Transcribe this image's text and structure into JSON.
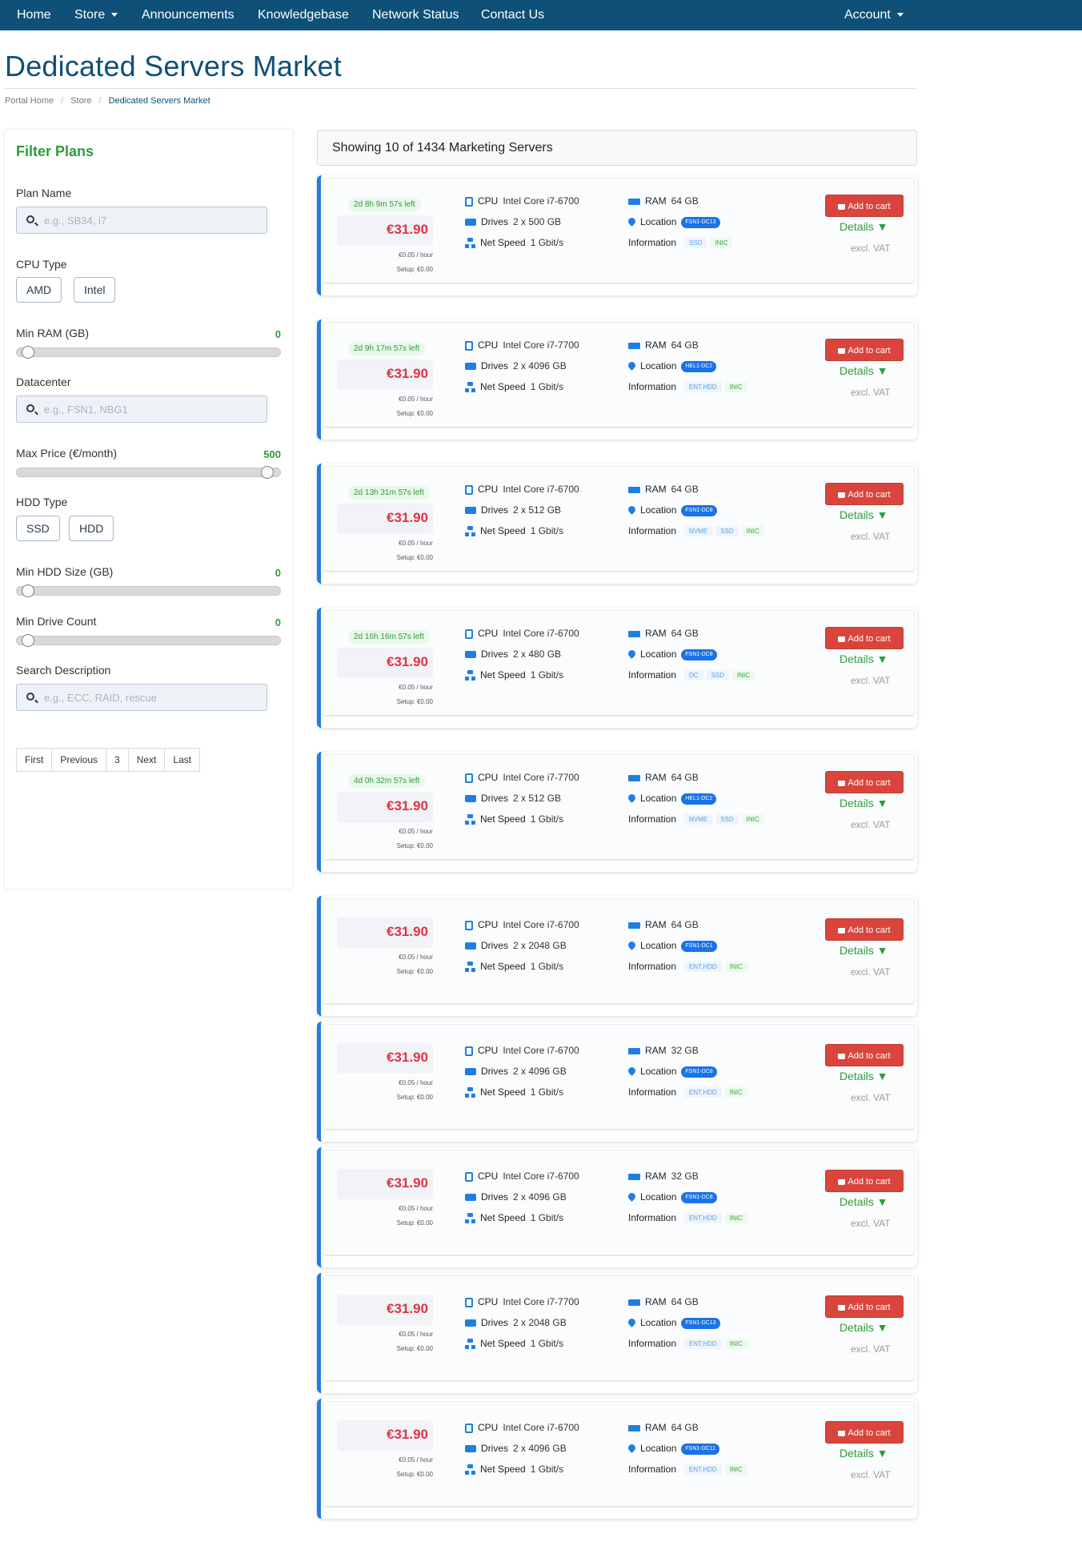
{
  "nav": {
    "home": "Home",
    "store": "Store",
    "announcements": "Announcements",
    "knowledgebase": "Knowledgebase",
    "network_status": "Network Status",
    "contact": "Contact Us",
    "account": "Account"
  },
  "page": {
    "title": "Dedicated Servers Market",
    "breadcrumb": [
      "Portal Home",
      "Store",
      "Dedicated Servers Market"
    ]
  },
  "filters": {
    "title": "Filter Plans",
    "plan_name_label": "Plan Name",
    "plan_name_placeholder": "e.g., SB34, i7",
    "cpu_type_label": "CPU Type",
    "cpu_options": [
      "AMD",
      "Intel"
    ],
    "min_ram_label": "Min RAM (GB)",
    "min_ram_value": "0",
    "datacenter_label": "Datacenter",
    "datacenter_placeholder": "e.g., FSN1, NBG1",
    "max_price_label": "Max Price (€/month)",
    "max_price_value": "500",
    "hdd_type_label": "HDD Type",
    "hdd_options": [
      "SSD",
      "HDD"
    ],
    "min_hdd_label": "Min HDD Size (GB)",
    "min_hdd_value": "0",
    "min_drive_label": "Min Drive Count",
    "min_drive_value": "0",
    "search_label": "Search Description",
    "search_placeholder": "e.g., ECC, RAID, rescue"
  },
  "pagination": {
    "first": "First",
    "previous": "Previous",
    "current": "3",
    "next": "Next",
    "last": "Last"
  },
  "results": {
    "showing": "Showing 10 of 1434 Marketing Servers"
  },
  "labels": {
    "cpu": "CPU",
    "drives": "Drives",
    "net_speed": "Net Speed",
    "ram": "RAM",
    "location": "Location",
    "information": "Information",
    "add_to_cart": "Add to cart",
    "details": "Details ▼",
    "excl_vat": "excl. VAT"
  },
  "colors": {
    "nav_bg": "#0e5077",
    "accent_blue": "#1f7fe0",
    "price_red": "#dc3545",
    "filter_green": "#2e9b3a",
    "cart_red": "#d9453d"
  },
  "servers": [
    {
      "timer": "2d 8h 9m 57s left",
      "price": "€31.90",
      "hourly": "€0.05 / hour",
      "setup": "Setup: €0.00",
      "cpu": "Intel Core i7-6700",
      "drives": "2 x 500 GB",
      "net": "1 Gbit/s",
      "ram": "64 GB",
      "location": "FSN1-DC13",
      "tags": [
        {
          "t": "SSD",
          "c": "blue"
        },
        {
          "t": "INIC",
          "c": "green"
        }
      ]
    },
    {
      "timer": "2d 9h 17m 57s left",
      "price": "€31.90",
      "hourly": "€0.05 / hour",
      "setup": "Setup: €0.00",
      "cpu": "Intel Core i7-7700",
      "drives": "2 x 4096 GB",
      "net": "1 Gbit/s",
      "ram": "64 GB",
      "location": "HEL1-DC2",
      "tags": [
        {
          "t": "ENT.HDD",
          "c": "blue"
        },
        {
          "t": "INIC",
          "c": "green"
        }
      ]
    },
    {
      "timer": "2d 13h 31m 57s left",
      "price": "€31.90",
      "hourly": "€0.05 / hour",
      "setup": "Setup: €0.00",
      "cpu": "Intel Core i7-6700",
      "drives": "2 x 512 GB",
      "net": "1 Gbit/s",
      "ram": "64 GB",
      "location": "FSN1-DC8",
      "tags": [
        {
          "t": "NVME",
          "c": "blue"
        },
        {
          "t": "SSD",
          "c": "blue"
        },
        {
          "t": "INIC",
          "c": "green"
        }
      ]
    },
    {
      "timer": "2d 16h 16m 57s left",
      "price": "€31.90",
      "hourly": "€0.05 / hour",
      "setup": "Setup: €0.00",
      "cpu": "Intel Core i7-6700",
      "drives": "2 x 480 GB",
      "net": "1 Gbit/s",
      "ram": "64 GB",
      "location": "FSN1-DC8",
      "tags": [
        {
          "t": "DC",
          "c": "blue"
        },
        {
          "t": "SSD",
          "c": "blue"
        },
        {
          "t": "INIC",
          "c": "green"
        }
      ]
    },
    {
      "timer": "4d 0h 32m 57s left",
      "price": "€31.90",
      "hourly": "€0.05 / hour",
      "setup": "Setup: €0.00",
      "cpu": "Intel Core i7-7700",
      "drives": "2 x 512 GB",
      "net": "1 Gbit/s",
      "ram": "64 GB",
      "location": "HEL1-DC2",
      "tags": [
        {
          "t": "NVME",
          "c": "blue"
        },
        {
          "t": "SSD",
          "c": "blue"
        },
        {
          "t": "INIC",
          "c": "green"
        }
      ]
    },
    {
      "timer": "",
      "price": "€31.90",
      "hourly": "€0.05 / hour",
      "setup": "Setup: €0.00",
      "cpu": "Intel Core i7-6700",
      "drives": "2 x 2048 GB",
      "net": "1 Gbit/s",
      "ram": "64 GB",
      "location": "FSN1-DC1",
      "tags": [
        {
          "t": "ENT.HDD",
          "c": "blue"
        },
        {
          "t": "INIC",
          "c": "green"
        }
      ]
    },
    {
      "timer": "",
      "price": "€31.90",
      "hourly": "€0.05 / hour",
      "setup": "Setup: €0.00",
      "cpu": "Intel Core i7-6700",
      "drives": "2 x 4096 GB",
      "net": "1 Gbit/s",
      "ram": "32 GB",
      "location": "FSN1-DC8",
      "tags": [
        {
          "t": "ENT.HDD",
          "c": "blue"
        },
        {
          "t": "INIC",
          "c": "green"
        }
      ]
    },
    {
      "timer": "",
      "price": "€31.90",
      "hourly": "€0.05 / hour",
      "setup": "Setup: €0.00",
      "cpu": "Intel Core i7-6700",
      "drives": "2 x 4096 GB",
      "net": "1 Gbit/s",
      "ram": "32 GB",
      "location": "FSN1-DC8",
      "tags": [
        {
          "t": "ENT.HDD",
          "c": "blue"
        },
        {
          "t": "INIC",
          "c": "green"
        }
      ]
    },
    {
      "timer": "",
      "price": "€31.90",
      "hourly": "€0.05 / hour",
      "setup": "Setup: €0.00",
      "cpu": "Intel Core i7-7700",
      "drives": "2 x 2048 GB",
      "net": "1 Gbit/s",
      "ram": "64 GB",
      "location": "FSN1-DC13",
      "tags": [
        {
          "t": "ENT.HDD",
          "c": "blue"
        },
        {
          "t": "INIC",
          "c": "green"
        }
      ]
    },
    {
      "timer": "",
      "price": "€31.90",
      "hourly": "€0.05 / hour",
      "setup": "Setup: €0.00",
      "cpu": "Intel Core i7-6700",
      "drives": "2 x 4096 GB",
      "net": "1 Gbit/s",
      "ram": "64 GB",
      "location": "FSN1-DC11",
      "tags": [
        {
          "t": "ENT.HDD",
          "c": "blue"
        },
        {
          "t": "INIC",
          "c": "green"
        }
      ]
    }
  ]
}
